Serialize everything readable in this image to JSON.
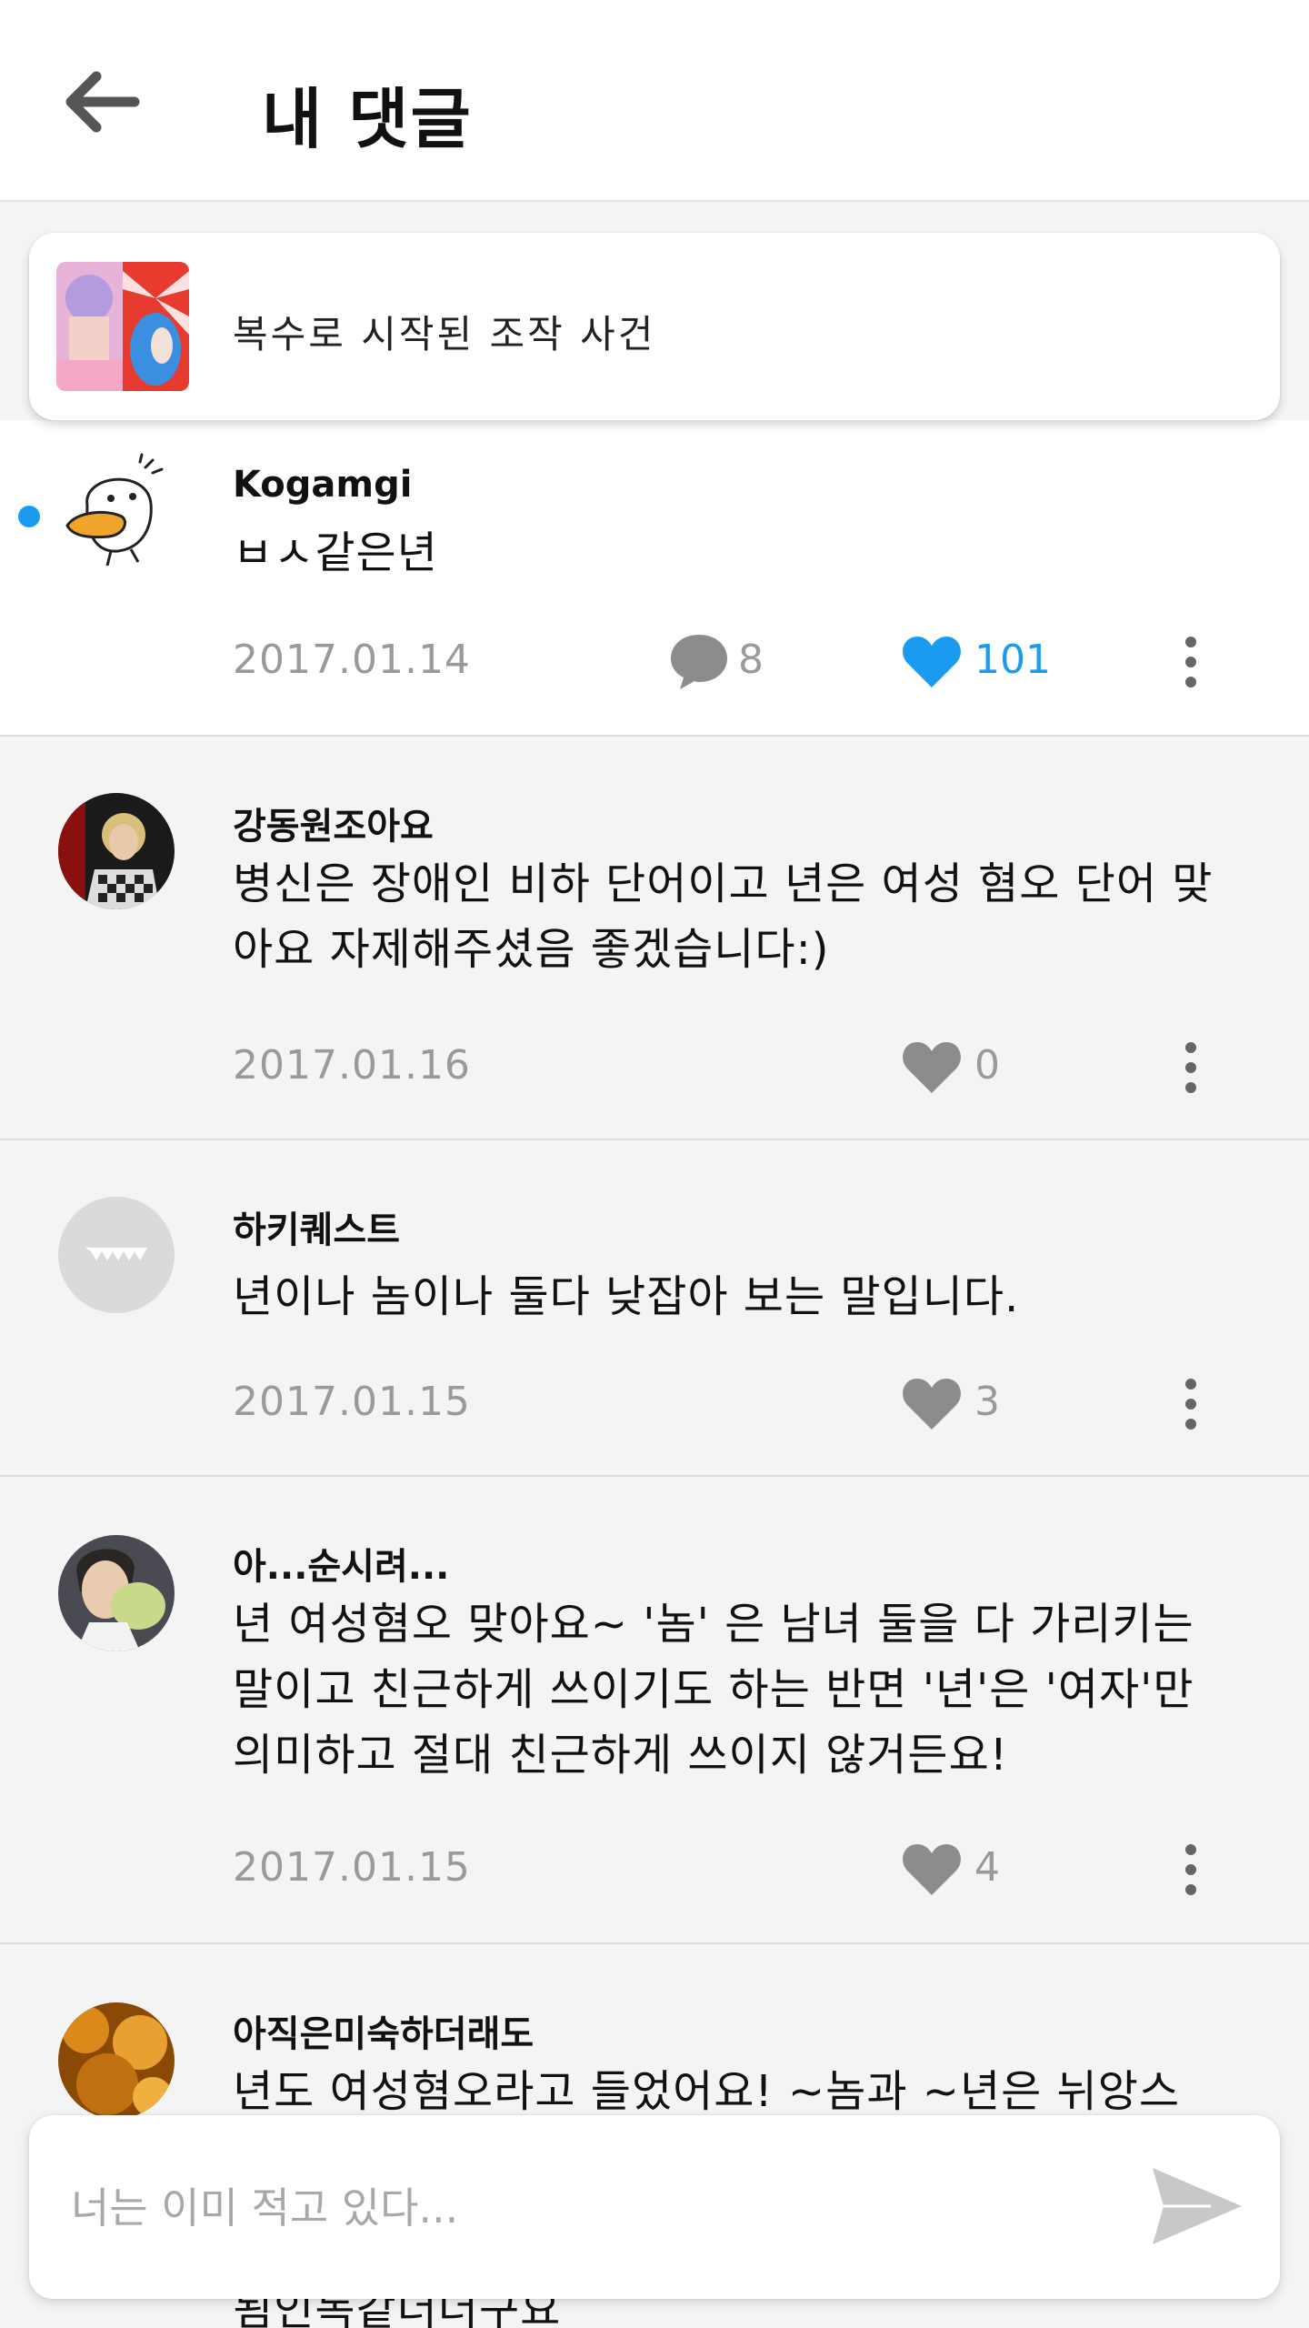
{
  "header": {
    "title": "내 댓글"
  },
  "article": {
    "title": "복수로 시작된 조작 사건"
  },
  "comments": [
    {
      "username": "Kogamgi",
      "text": "ㅂㅅ같은년",
      "date": "2017.01.14",
      "reply_count": "8",
      "like_count": "101",
      "liked": true
    },
    {
      "username": "강동원조아요",
      "text": "병신은 장애인 비하 단어이고 년은 여성 혐오 단어 맞아요 자제해주셨음 좋겠습니다:)",
      "date": "2017.01.16",
      "like_count": "0",
      "liked": false
    },
    {
      "username": "하키퀘스트",
      "text": "년이나 놈이나 둘다 낮잡아 보는 말입니다.",
      "date": "2017.01.15",
      "like_count": "3",
      "liked": false
    },
    {
      "username": "아...순시려...",
      "text": "년 여성혐오 맞아요~ '놈' 은 남녀 둘을 다 가리키는 말이고 친근하게 쓰이기도 하는 반면 '년'은 '여자'만 의미하고 절대 친근하게 쓰이지 않거든요!",
      "date": "2017.01.15",
      "like_count": "4",
      "liked": false
    },
    {
      "username": "아직은미숙하더래도",
      "text": "년도 여성혐오라고 들었어요! ~놈과 ~년은 뉘앙스"
    },
    {
      "text": "됨인독같더더구요"
    }
  ],
  "input": {
    "placeholder": "너는 이미 적고 있다..."
  },
  "colors": {
    "accent": "#1a9bef",
    "muted": "#9a9a9a",
    "icon_gray": "#8c8c8c"
  }
}
